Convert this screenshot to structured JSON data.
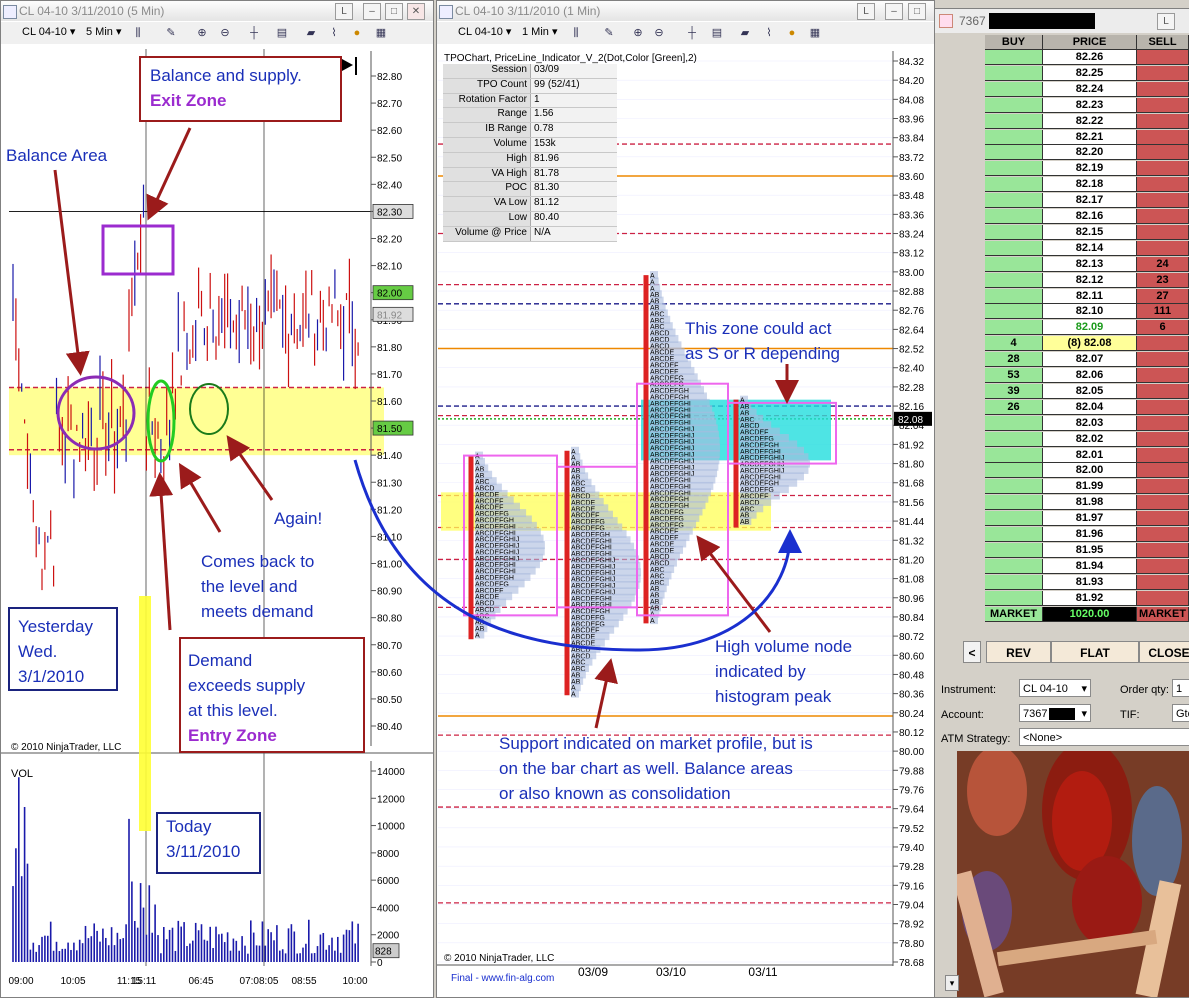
{
  "left_window": {
    "title": "CL 04-10  3/11/2010 (5 Min)",
    "instrument": "CL 04-10",
    "interval": "5 Min",
    "copyright": "© 2010 NinjaTrader, LLC",
    "vol_label": "VOL",
    "price_ticks": [
      "82.80",
      "82.70",
      "82.60",
      "82.50",
      "82.40",
      "82.30",
      "82.20",
      "82.10",
      "82.00",
      "81.90",
      "81.80",
      "81.70",
      "81.60",
      "81.50",
      "81.40",
      "81.30",
      "81.20",
      "81.10",
      "81.00",
      "80.90",
      "80.80",
      "80.70",
      "80.60",
      "80.50",
      "80.40"
    ],
    "vol_ticks": [
      "14000",
      "12000",
      "10000",
      "8000",
      "6000",
      "4000",
      "2000",
      "0"
    ],
    "time_ticks": [
      "09:00",
      "10:05",
      "11:15",
      "15:11",
      "06:45",
      "07:08:05",
      "08:55",
      "10:00"
    ],
    "price_tags": {
      "p8230": "82.30",
      "p8200": "82.00",
      "p8192": "81.92",
      "p8150": "81.50"
    },
    "vol_tag": "828",
    "btn_L": "L"
  },
  "right_window": {
    "title": "CL 04-10  3/11/2010 (1 Min)",
    "instrument": "CL 04-10",
    "interval": "1 Min",
    "indicator_line": "TPOChart, PriceLine_Indicator_V_2(Dot,Color [Green],2)",
    "stats": [
      {
        "k": "Session",
        "v": "03/09"
      },
      {
        "k": "TPO Count",
        "v": "99 (52/41)"
      },
      {
        "k": "Rotation Factor",
        "v": "1"
      },
      {
        "k": "Range",
        "v": "1.56"
      },
      {
        "k": "IB Range",
        "v": "0.78"
      },
      {
        "k": "Volume",
        "v": "153k"
      },
      {
        "k": "High",
        "v": "81.96"
      },
      {
        "k": "VA High",
        "v": "81.78"
      },
      {
        "k": "POC",
        "v": "81.30"
      },
      {
        "k": "VA Low",
        "v": "81.12"
      },
      {
        "k": "Low",
        "v": "80.40"
      },
      {
        "k": "Volume @ Price",
        "v": "N/A"
      }
    ],
    "price_ticks": [
      "84.32",
      "84.20",
      "84.08",
      "83.96",
      "83.84",
      "83.72",
      "83.60",
      "83.48",
      "83.36",
      "83.24",
      "83.12",
      "83.00",
      "82.88",
      "82.76",
      "82.64",
      "82.52",
      "82.40",
      "82.28",
      "82.16",
      "82.04",
      "81.92",
      "81.80",
      "81.68",
      "81.56",
      "81.44",
      "81.32",
      "81.20",
      "81.08",
      "80.96",
      "80.84",
      "80.72",
      "80.60",
      "80.48",
      "80.36",
      "80.24",
      "80.12",
      "80.00",
      "79.88",
      "79.76",
      "79.64",
      "79.52",
      "79.40",
      "79.28",
      "79.16",
      "79.04",
      "78.92",
      "78.80",
      "78.68"
    ],
    "price_tag": "82.08",
    "date_ticks": [
      "03/09",
      "03/10",
      "03/11"
    ],
    "copyright": "© 2010 NinjaTrader, LLC",
    "footer": "Final - www.fin-alg.com",
    "btn_L": "L"
  },
  "dom": {
    "title": "7367",
    "headers": {
      "buy": "BUY",
      "price": "PRICE",
      "sell": "SELL"
    },
    "rows": [
      {
        "buy": "",
        "price": "82.26",
        "sell": ""
      },
      {
        "buy": "",
        "price": "82.25",
        "sell": ""
      },
      {
        "buy": "",
        "price": "82.24",
        "sell": ""
      },
      {
        "buy": "",
        "price": "82.23",
        "sell": ""
      },
      {
        "buy": "",
        "price": "82.22",
        "sell": ""
      },
      {
        "buy": "",
        "price": "82.21",
        "sell": ""
      },
      {
        "buy": "",
        "price": "82.20",
        "sell": ""
      },
      {
        "buy": "",
        "price": "82.19",
        "sell": ""
      },
      {
        "buy": "",
        "price": "82.18",
        "sell": ""
      },
      {
        "buy": "",
        "price": "82.17",
        "sell": ""
      },
      {
        "buy": "",
        "price": "82.16",
        "sell": ""
      },
      {
        "buy": "",
        "price": "82.15",
        "sell": ""
      },
      {
        "buy": "",
        "price": "82.14",
        "sell": ""
      },
      {
        "buy": "",
        "price": "82.13",
        "sell": "24"
      },
      {
        "buy": "",
        "price": "82.12",
        "sell": "23"
      },
      {
        "buy": "",
        "price": "82.11",
        "sell": "27"
      },
      {
        "buy": "",
        "price": "82.10",
        "sell": "111"
      },
      {
        "buy": "",
        "price": "82.09",
        "sell": "6"
      },
      {
        "buy": "4",
        "price": "(8) 82.08",
        "sell": ""
      },
      {
        "buy": "28",
        "price": "82.07",
        "sell": ""
      },
      {
        "buy": "53",
        "price": "82.06",
        "sell": ""
      },
      {
        "buy": "39",
        "price": "82.05",
        "sell": ""
      },
      {
        "buy": "26",
        "price": "82.04",
        "sell": ""
      },
      {
        "buy": "",
        "price": "82.03",
        "sell": ""
      },
      {
        "buy": "",
        "price": "82.02",
        "sell": ""
      },
      {
        "buy": "",
        "price": "82.01",
        "sell": ""
      },
      {
        "buy": "",
        "price": "82.00",
        "sell": ""
      },
      {
        "buy": "",
        "price": "81.99",
        "sell": ""
      },
      {
        "buy": "",
        "price": "81.98",
        "sell": ""
      },
      {
        "buy": "",
        "price": "81.97",
        "sell": ""
      },
      {
        "buy": "",
        "price": "81.96",
        "sell": ""
      },
      {
        "buy": "",
        "price": "81.95",
        "sell": ""
      },
      {
        "buy": "",
        "price": "81.94",
        "sell": ""
      },
      {
        "buy": "",
        "price": "81.93",
        "sell": ""
      },
      {
        "buy": "",
        "price": "81.92",
        "sell": ""
      }
    ],
    "market_row": {
      "buy": "MARKET",
      "price": "1020.00",
      "sell": "MARKET"
    },
    "buttons": {
      "back": "<",
      "rev": "REV",
      "flat": "FLAT",
      "close": "CLOSE"
    },
    "instrument_label": "Instrument:",
    "instrument_value": "CL 04-10",
    "order_qty_label": "Order qty:",
    "order_qty_value": "1",
    "account_label": "Account:",
    "account_value": "7367",
    "tif_label": "TIF:",
    "tif_value": "Gtc",
    "atm_label": "ATM Strategy:",
    "atm_value": "<None>",
    "colors": {
      "buy": "#99e699",
      "sell": "#cc5555",
      "price_bg": "#ffffff",
      "last": "#ffff99"
    }
  },
  "annotations": {
    "balance_supply_line1": "Balance and supply.",
    "exit_zone": "Exit Zone",
    "balance_area": "Balance Area",
    "again": "Again!",
    "comes_back_1": "Comes back to",
    "comes_back_2": "the level and",
    "comes_back_3": "meets demand",
    "yesterday_1": "Yesterday",
    "yesterday_2": "Wed.",
    "yesterday_3": "3/1/2010",
    "demand_1": "Demand",
    "demand_2": "exceeds supply",
    "demand_3": "at this level.",
    "entry_zone": "Entry Zone",
    "today_1": "Today",
    "today_2": "3/11/2010",
    "zone_1": "This zone could act",
    "zone_2": "as S or R depending",
    "hvn_1": "High volume node",
    "hvn_2": "indicated by",
    "hvn_3": "histogram peak",
    "support_1": "Support indicated on market profile, but is",
    "support_2": "on the bar chart as well.  Balance areas",
    "support_3": "or also known as consolidation"
  },
  "chart_data": [
    {
      "type": "bar",
      "subtype": "ohlc_price_and_volume",
      "title": "CL 04-10  3/11/2010 (5 Min)",
      "ylim": [
        80.35,
        82.85
      ],
      "vol_ylim": [
        0,
        15000
      ],
      "x": [
        "09:00",
        "10:05",
        "11:15",
        "15:11",
        "06:45",
        "07:08:05",
        "08:55",
        "10:00"
      ],
      "balance_zone": [
        81.4,
        81.65
      ],
      "last_price": 81.92,
      "reference_levels": [
        82.3,
        82.0,
        81.5
      ]
    },
    {
      "type": "bar",
      "subtype": "market_profile_tpo",
      "title": "TPOChart, PriceLine_Indicator_V_2(Dot,Color [Green],2)",
      "ylim": [
        78.68,
        84.32
      ],
      "sessions": [
        "03/09",
        "03/10",
        "03/11"
      ],
      "session_0309": {
        "high": 81.96,
        "va_high": 81.78,
        "poc": 81.3,
        "va_low": 81.12,
        "low": 80.4,
        "range": 1.56,
        "ib_range": 0.78,
        "volume": "153k",
        "tpo_count": "99 (52/41)",
        "rotation_factor": 1
      },
      "last_price": 82.08
    }
  ]
}
